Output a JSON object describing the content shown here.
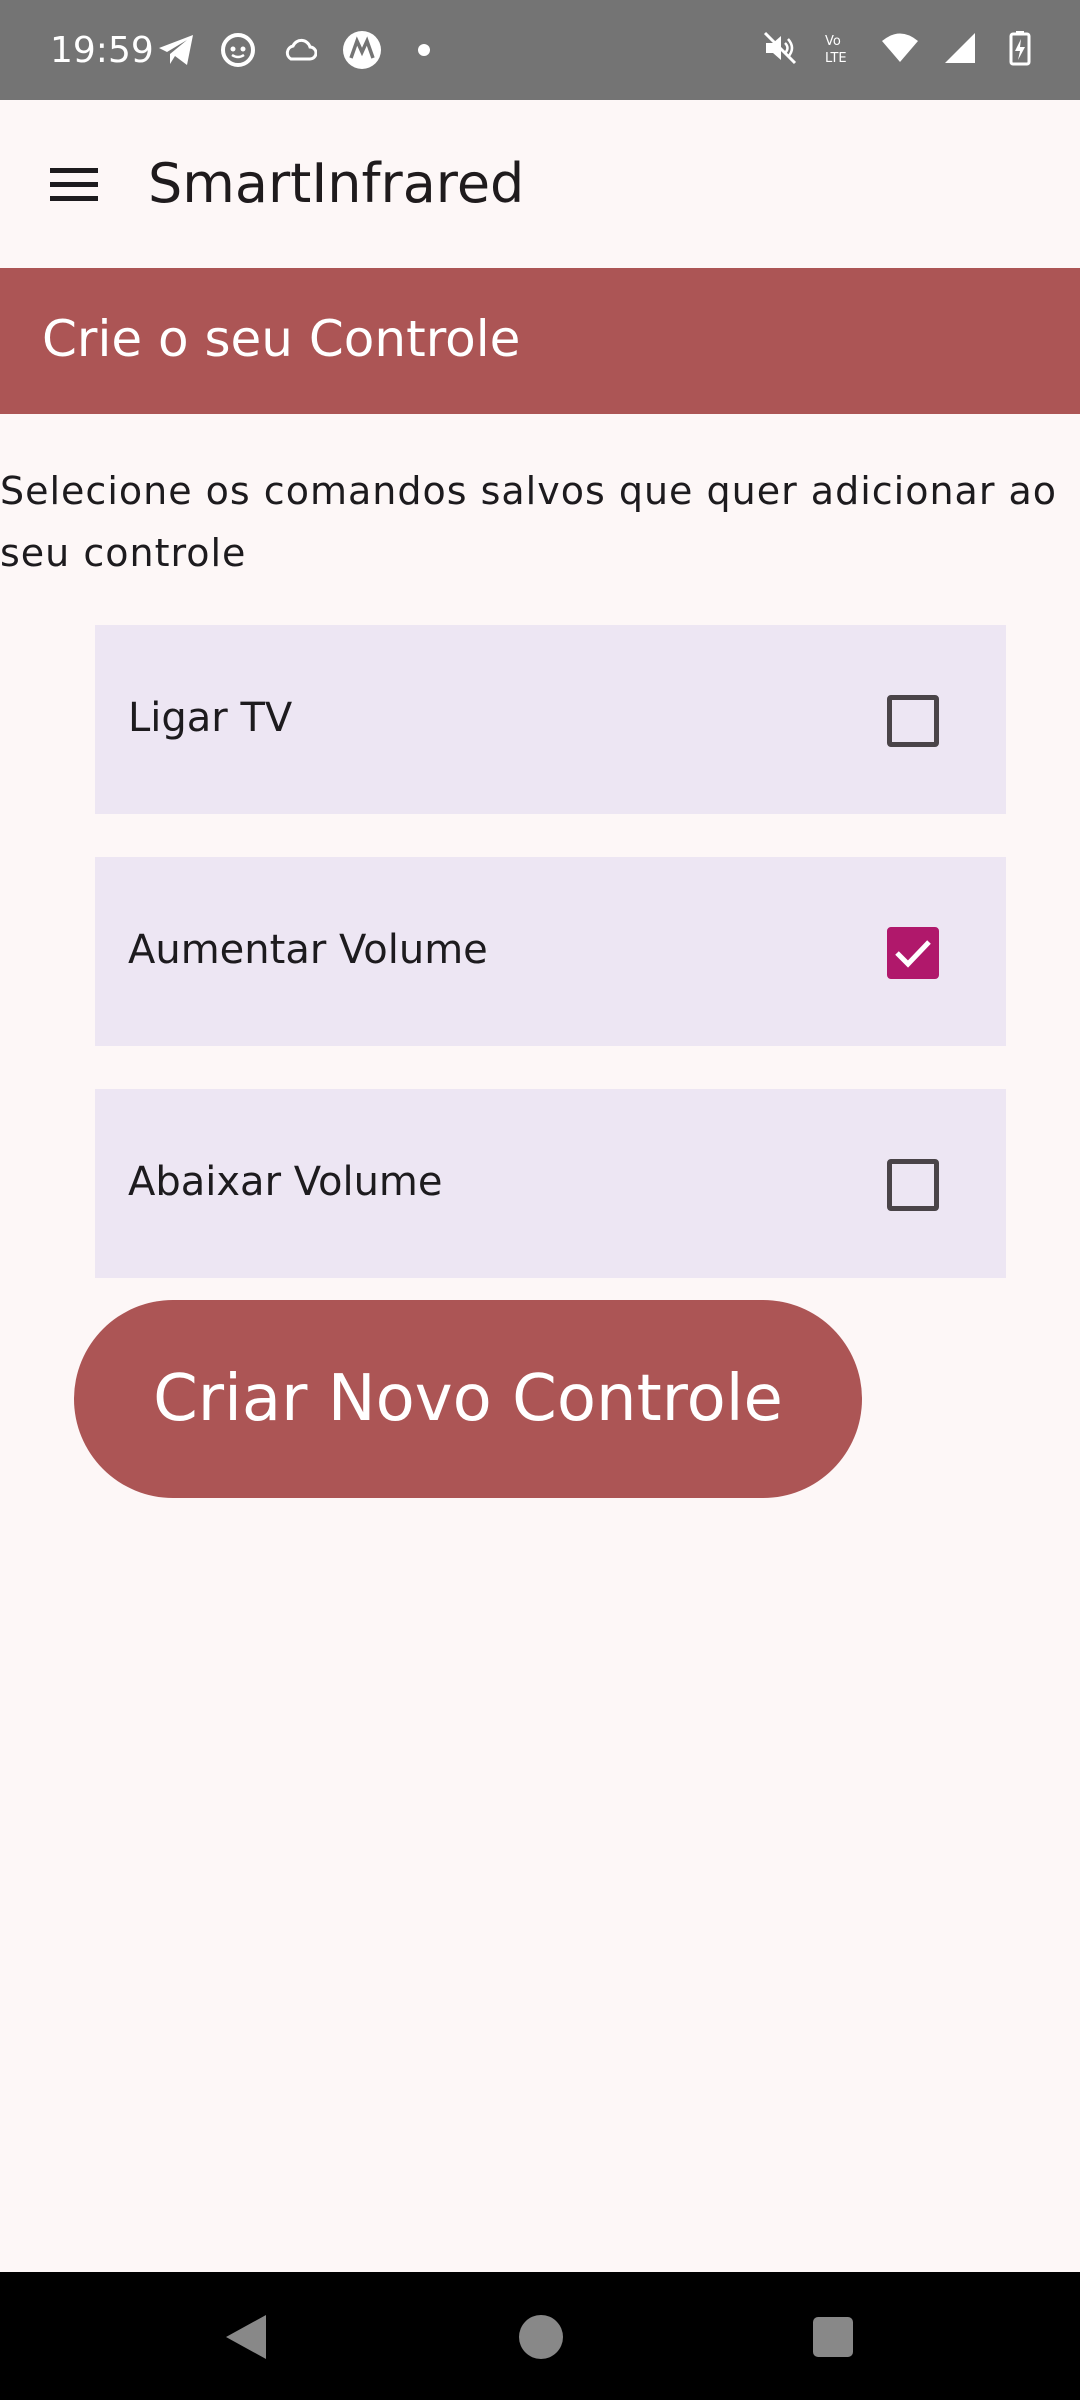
{
  "status_bar": {
    "time": "19:59",
    "left_icons": [
      "telegram-icon",
      "reddit-icon",
      "cloud-icon",
      "motorola-icon",
      "dot-icon"
    ],
    "right_icons": [
      "mute-icon",
      "volte-icon",
      "wifi-icon",
      "signal-icon",
      "battery-charging-icon"
    ]
  },
  "app_bar": {
    "title": "SmartInfrared",
    "menu_icon": "menu-icon"
  },
  "section": {
    "header": "Crie o seu Controle",
    "instructions": "Selecione os comandos salvos que quer adicionar ao seu controle"
  },
  "commands": [
    {
      "label": "Ligar TV",
      "checked": false
    },
    {
      "label": "Aumentar Volume",
      "checked": true
    },
    {
      "label": "Abaixar Volume",
      "checked": false
    }
  ],
  "create_button": {
    "label": "Criar Novo Controle"
  },
  "colors": {
    "primary": "#ac5555",
    "checkbox_checked": "#b0186b",
    "list_item_bg": "#ede6f3",
    "page_bg": "#fdf7f7"
  },
  "nav_bar": {
    "icons": [
      "back-icon",
      "home-icon",
      "recents-icon"
    ]
  }
}
